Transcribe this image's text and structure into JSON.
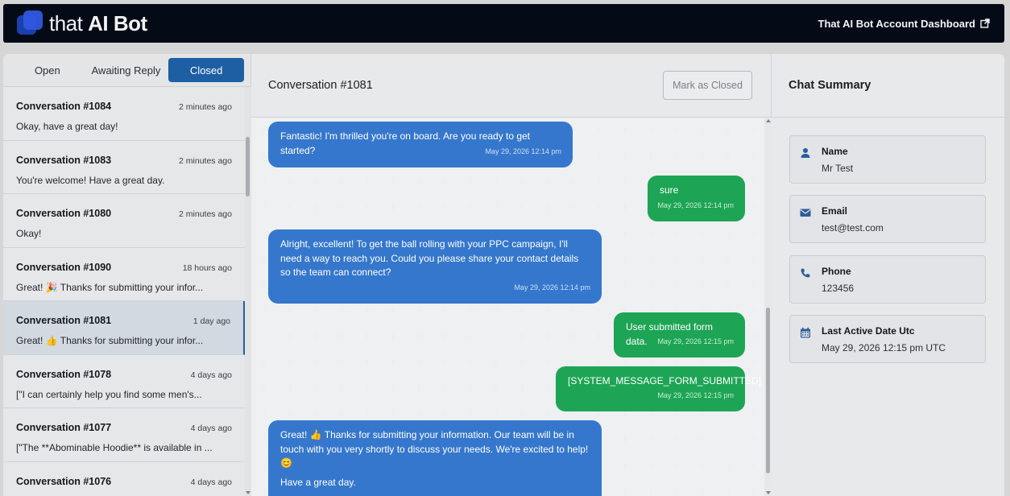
{
  "header": {
    "brand_light": "that",
    "brand_bold": "AI Bot",
    "dashboard_link": "That AI Bot Account Dashboard"
  },
  "tabs": [
    {
      "label": "Open"
    },
    {
      "label": "Awaiting Reply"
    },
    {
      "label": "Closed",
      "active": true
    }
  ],
  "conversations": [
    {
      "title": "Conversation #1084",
      "time": "2 minutes ago",
      "snippet": "Okay, have a great day!"
    },
    {
      "title": "Conversation #1083",
      "time": "2 minutes ago",
      "snippet": "You're welcome! Have a great day."
    },
    {
      "title": "Conversation #1080",
      "time": "2 minutes ago",
      "snippet": "Okay!"
    },
    {
      "title": "Conversation #1090",
      "time": "18 hours ago",
      "snippet": "Great! 🎉 Thanks for submitting your infor..."
    },
    {
      "title": "Conversation #1081",
      "time": "1 day ago",
      "snippet": "Great! 👍 Thanks for submitting your infor...",
      "active": true
    },
    {
      "title": "Conversation #1078",
      "time": "4 days ago",
      "snippet": "[\"I can certainly help you find some men's..."
    },
    {
      "title": "Conversation #1077",
      "time": "4 days ago",
      "snippet": "[\"The **Abominable Hoodie** is available in ..."
    },
    {
      "title": "Conversation #1076",
      "time": "4 days ago",
      "snippet": ""
    }
  ],
  "chat": {
    "title": "Conversation #1081",
    "mark_closed_label": "Mark as Closed",
    "messages": [
      {
        "from": "bot",
        "text": "Fantastic! I'm thrilled you're on board. Are you ready to get started?",
        "time": "May 29, 2026 12:14 pm"
      },
      {
        "from": "user",
        "text": "sure",
        "time": "May 29, 2026 12:14 pm"
      },
      {
        "from": "bot",
        "text": "Alright, excellent! To get the ball rolling with your PPC campaign, I'll need a way to reach you. Could you please share your contact details so the team can connect?",
        "time": "May 29, 2026 12:14 pm"
      },
      {
        "from": "user",
        "text": "User submitted form data.",
        "time": "May 29, 2026 12:15 pm"
      },
      {
        "from": "user",
        "text": "[SYSTEM_MESSAGE_FORM_SUBMITTED]",
        "time": "May 29, 2026 12:15 pm"
      },
      {
        "from": "bot",
        "text": "Great! 👍 Thanks for submitting your information. Our team will be in touch with you very shortly to discuss your needs. We're excited to help! 😊",
        "text2": "Have a great day.",
        "time": ""
      }
    ]
  },
  "summary": {
    "title": "Chat Summary",
    "fields": [
      {
        "label": "Name",
        "value": "Mr Test",
        "icon": "user-icon"
      },
      {
        "label": "Email",
        "value": "test@test.com",
        "icon": "envelope-icon"
      },
      {
        "label": "Phone",
        "value": "123456",
        "icon": "phone-icon"
      },
      {
        "label": "Last Active Date Utc",
        "value": "May 29, 2026 12:15 pm UTC",
        "icon": "calendar-icon"
      }
    ]
  },
  "colors": {
    "accent": "#1e5fa3",
    "bot_bubble": "#3577cc",
    "user_bubble": "#1ea455",
    "topbar": "#050b16"
  }
}
